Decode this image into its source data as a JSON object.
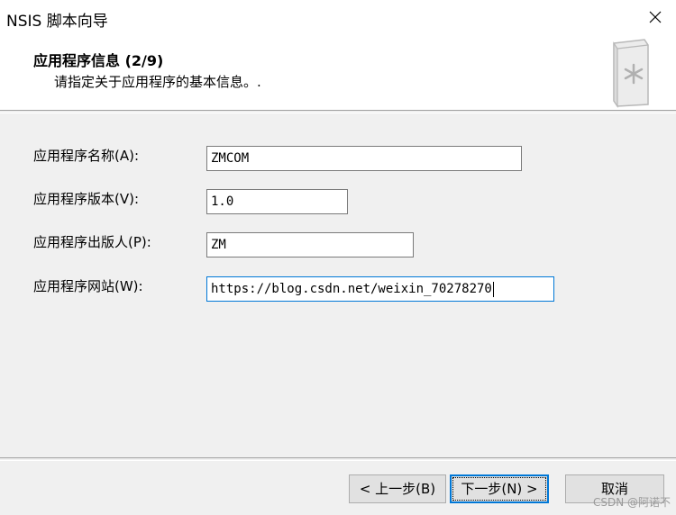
{
  "window": {
    "title": "NSIS 脚本向导"
  },
  "header": {
    "title": "应用程序信息 (2/9)",
    "subtitle": "请指定关于应用程序的基本信息。."
  },
  "form": {
    "fields": [
      {
        "label": "应用程序名称(A):",
        "value": "ZMCOM"
      },
      {
        "label": "应用程序版本(V):",
        "value": "1.0"
      },
      {
        "label": "应用程序出版人(P):",
        "value": "ZM"
      },
      {
        "label": "应用程序网站(W):",
        "value": "https://blog.csdn.net/weixin_70278270"
      }
    ]
  },
  "buttons": {
    "back": "< 上一步(B)",
    "next": "下一步(N) >",
    "cancel": "取消"
  },
  "watermark": "CSDN @阿诺不",
  "colors": {
    "focus": "#0078d7",
    "window_bg": "#f0f0f0"
  }
}
